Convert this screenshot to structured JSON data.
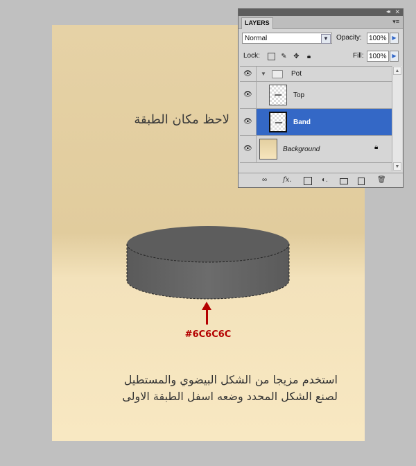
{
  "canvas": {
    "note_top": "لاحظ مكان الطبقة",
    "color_label": "#6C6C6C",
    "note_bottom_line1": "استخدم مزيجا من الشكل البيضوي والمستطيل",
    "note_bottom_line2": "لصنع الشكل المحدد وضعه اسفل الطبقة الاولى",
    "band_color": "#6C6C6C"
  },
  "layers_panel": {
    "tab": "LAYERS",
    "blend_mode": "Normal",
    "opacity_label": "Opacity:",
    "opacity_value": "100%",
    "lock_label": "Lock:",
    "fill_label": "Fill:",
    "fill_value": "100%",
    "layers": [
      {
        "name": "Pot",
        "type": "group",
        "selected": false
      },
      {
        "name": "Top",
        "type": "layer",
        "selected": false
      },
      {
        "name": "Band",
        "type": "layer",
        "selected": true
      },
      {
        "name": "Background",
        "type": "background",
        "locked": true
      }
    ],
    "bottom_icons": [
      "link-icon",
      "fx-icon",
      "mask-icon",
      "adjustment-icon",
      "group-icon",
      "new-layer-icon",
      "trash-icon"
    ]
  }
}
